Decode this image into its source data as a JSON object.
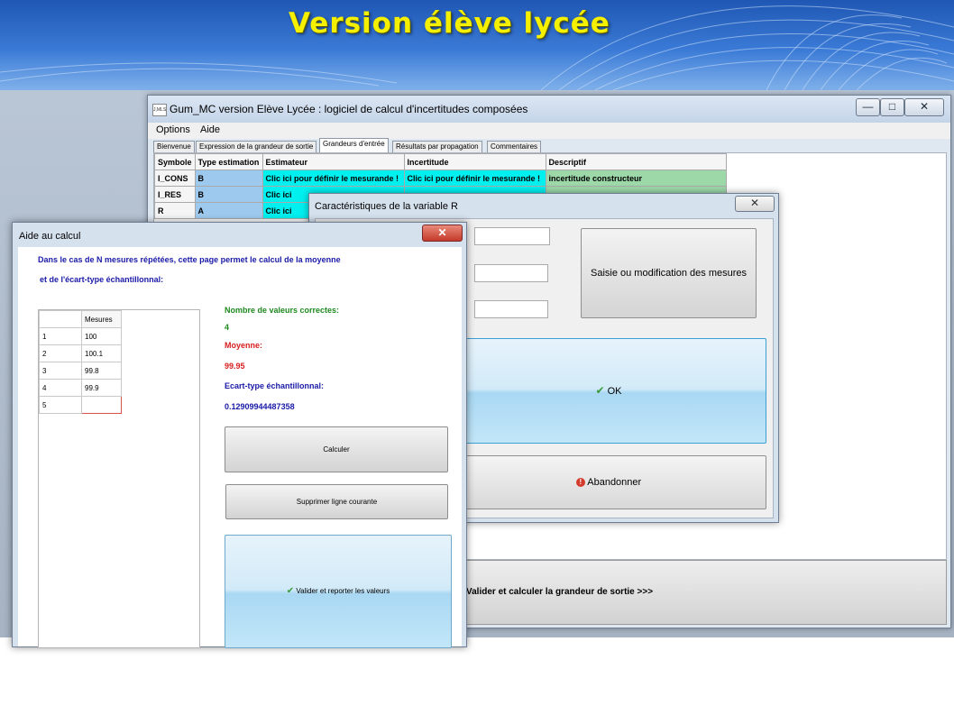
{
  "banner": {
    "title": "Version élève lycée"
  },
  "main_window": {
    "icon_text": "J,MLS",
    "title": "Gum_MC version Elève Lycée : logiciel de calcul d'incertitudes composées",
    "controls": {
      "minimize": "—",
      "maximize": "□",
      "close": "✕"
    },
    "menu": [
      "Options",
      "Aide"
    ],
    "tabs": [
      {
        "label": "Bienvenue"
      },
      {
        "label": "Expression de la grandeur de sortie"
      },
      {
        "label": "Grandeurs d'entrée"
      },
      {
        "label": "Résultats par propagation"
      },
      {
        "label": "Commentaires"
      }
    ],
    "active_tab": "Grandeurs d'entrée",
    "table": {
      "headers": [
        "Symbole",
        "Type estimation",
        "Estimateur",
        "Incertitude",
        "Descriptif"
      ],
      "rows": [
        [
          "I_CONS",
          "B",
          "Clic ici pour définir le mesurande !",
          "Clic ici pour définir le mesurande !",
          "incertitude constructeur"
        ],
        [
          "I_RES",
          "B",
          "Clic ici",
          "",
          ""
        ],
        [
          "R",
          "A",
          "Clic ici",
          "",
          ""
        ]
      ]
    },
    "bottom_button": "Valider et calculer la grandeur de sortie >>>"
  },
  "char_dialog": {
    "title": "Caractéristiques de la variable R",
    "close": "✕",
    "mesures_button": "Saisie ou modification des mesures",
    "ok_button": "OK",
    "abandon_button": "Abandonner",
    "abandon_icon": "!"
  },
  "aide_dialog": {
    "title": "Aide au calcul",
    "close": "✕",
    "intro_line1": "Dans le cas de N mesures répétées, cette page permet le calcul de la moyenne",
    "intro_line2": "et de l'écart-type échantillonnal:",
    "table_header": "Mesures",
    "rows": [
      {
        "index": "1",
        "value": "100"
      },
      {
        "index": "2",
        "value": "100.1"
      },
      {
        "index": "3",
        "value": "99.8"
      },
      {
        "index": "4",
        "value": "99.9"
      },
      {
        "index": "5",
        "value": ""
      }
    ],
    "count_label": "Nombre de valeurs correctes:",
    "count_value": "4",
    "mean_label": "Moyenne:",
    "mean_value": "99.95",
    "std_label": "Ecart-type échantillonnal:",
    "std_value": "0.12909944487358",
    "calc_button": "Calculer",
    "delete_button": "Supprimer ligne courante",
    "validate_button": "Valider et reporter les valeurs"
  },
  "colors": {
    "banner_title": "#f5f000",
    "label_green": "#1e8a1e",
    "label_red": "#d81e1e",
    "label_blue": "#1a1aa8",
    "type_cell": "#9ec9ee",
    "estimateur_cell": "#00f0f0",
    "descriptif_cell": "#9cd8a8"
  }
}
